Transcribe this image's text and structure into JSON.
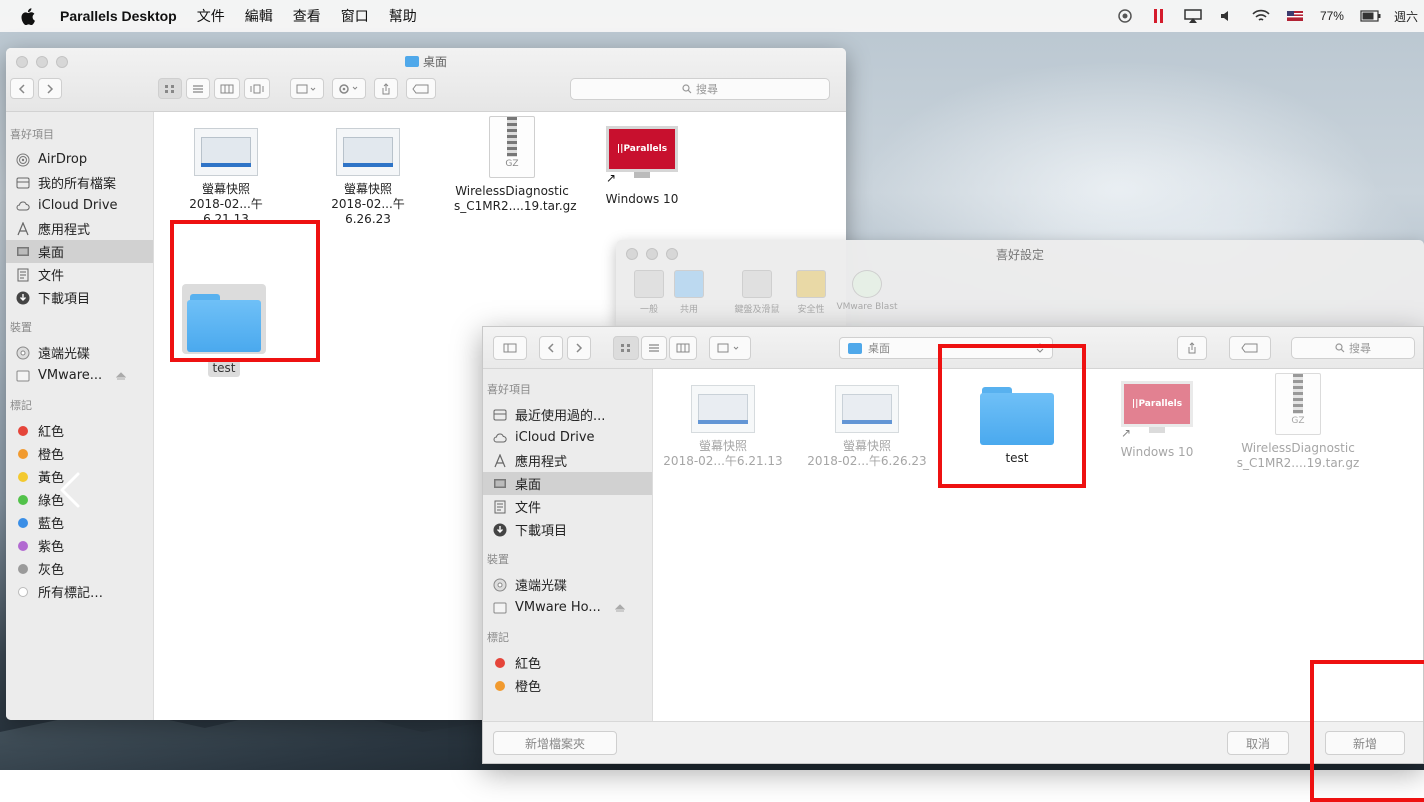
{
  "menubar": {
    "app_name": "Parallels Desktop",
    "menus": [
      "文件",
      "編輯",
      "查看",
      "窗口",
      "幫助"
    ],
    "battery": "77%",
    "clock": "週六"
  },
  "finder": {
    "title": "桌面",
    "search_placeholder": "搜尋",
    "sidebar": {
      "favorites_header": "喜好項目",
      "favorites": [
        "AirDrop",
        "我的所有檔案",
        "iCloud Drive",
        "應用程式",
        "桌面",
        "文件",
        "下載項目"
      ],
      "devices_header": "裝置",
      "devices": [
        "遠端光碟",
        "VMware..."
      ],
      "tags_header": "標記",
      "tags": [
        {
          "label": "紅色",
          "color": "#e5453a"
        },
        {
          "label": "橙色",
          "color": "#f19a2f"
        },
        {
          "label": "黃色",
          "color": "#f3c92f"
        },
        {
          "label": "綠色",
          "color": "#52c24a"
        },
        {
          "label": "藍色",
          "color": "#3a8ee6"
        },
        {
          "label": "紫色",
          "color": "#b26ad1"
        },
        {
          "label": "灰色",
          "color": "#9a9a9a"
        },
        {
          "label": "所有標記…",
          "color": "#d9d9d9"
        }
      ]
    },
    "files": [
      {
        "name": "螢幕快照",
        "sub": "2018-02...午6.21.13"
      },
      {
        "name": "螢幕快照",
        "sub": "2018-02...午6.26.23"
      },
      {
        "name": "WirelessDiagnostic",
        "sub": "s_C1MR2....19.tar.gz",
        "ext": "GZ"
      },
      {
        "name": "Windows 10",
        "badge": "||Parallels"
      },
      {
        "name": "test"
      }
    ]
  },
  "prefs": {
    "title": "喜好設定",
    "tabs": [
      "一般",
      "共用",
      "鍵盤及滑鼠",
      "安全性",
      "VMware Blast"
    ]
  },
  "dialog": {
    "path": "桌面",
    "search_placeholder": "搜尋",
    "sidebar": {
      "favorites_header": "喜好項目",
      "favorites": [
        "最近使用過的...",
        "iCloud Drive",
        "應用程式",
        "桌面",
        "文件",
        "下載項目"
      ],
      "devices_header": "裝置",
      "devices": [
        "遠端光碟",
        "VMware Ho..."
      ],
      "tags_header": "標記",
      "tags": [
        {
          "label": "紅色",
          "color": "#e5453a"
        },
        {
          "label": "橙色",
          "color": "#f19a2f"
        }
      ]
    },
    "files": [
      {
        "name": "螢幕快照",
        "sub": "2018-02...午6.21.13"
      },
      {
        "name": "螢幕快照",
        "sub": "2018-02...午6.26.23"
      },
      {
        "name": "test"
      },
      {
        "name": "Windows 10",
        "badge": "||Parallels"
      },
      {
        "name": "WirelessDiagnostic",
        "sub": "s_C1MR2....19.tar.gz",
        "ext": "GZ"
      }
    ],
    "new_folder_label": "新增檔案夾",
    "cancel_label": "取消",
    "add_label": "新增"
  }
}
